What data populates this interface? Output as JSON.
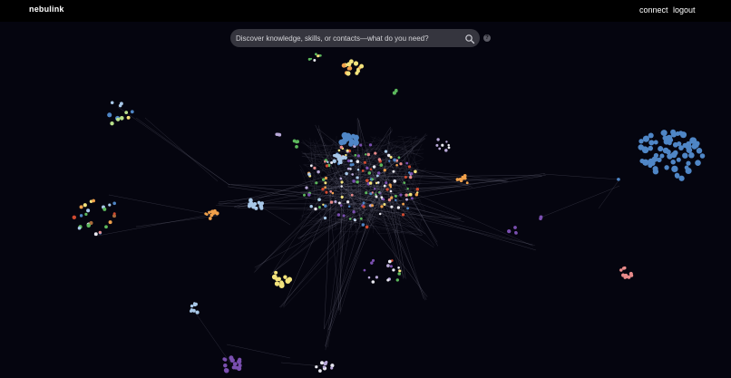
{
  "app": {
    "brand": "nebulink"
  },
  "nav": {
    "connect_label": "connect",
    "logout_label": "logout"
  },
  "search": {
    "placeholder": "Discover knowledge, skills, or contacts—what do you need?",
    "value": ""
  },
  "help": {
    "label": "?"
  },
  "graph": {
    "background": "#05050f",
    "edge_color": "#9a9ab0",
    "palette": {
      "blue": "#4f86c6",
      "yellow": "#f3e37c",
      "orange": "#f0a04b",
      "green": "#5cb85c",
      "purple": "#7a4fb0",
      "pink": "#e88a8a",
      "lightblue": "#a8c8e8",
      "white": "#e8e8f0",
      "red": "#d04a30",
      "lavender": "#b8a8d8",
      "brown": "#a86a3a",
      "lightgreen": "#b8e08a"
    }
  }
}
